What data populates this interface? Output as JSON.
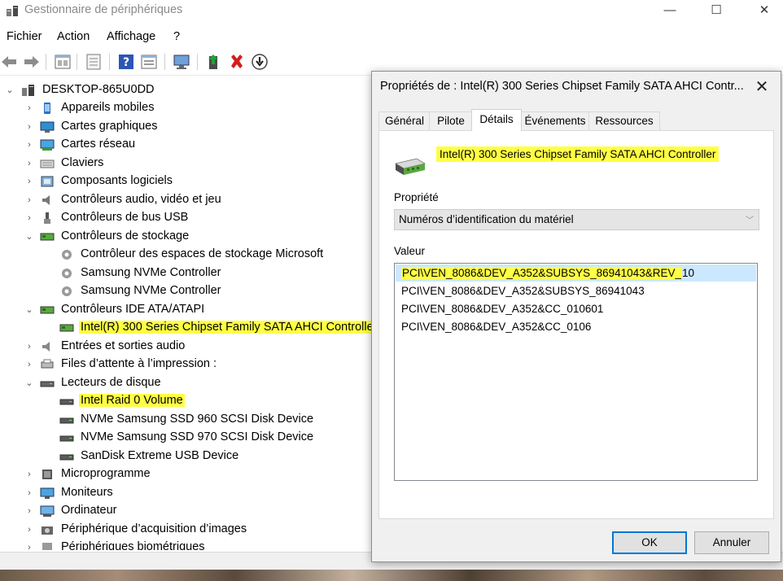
{
  "window": {
    "title": "Gestionnaire de périphériques",
    "minimize": "—",
    "maximize": "☐",
    "close": "✕"
  },
  "menu": [
    "Fichier",
    "Action",
    "Affichage",
    "?"
  ],
  "toolbar_icons": [
    "back-arrow-icon",
    "forward-arrow-icon",
    "properties-view-icon",
    "show-hidden-icon",
    "help-icon",
    "action-list-icon",
    "scan-hardware-icon",
    "enable-device-icon",
    "uninstall-device-icon",
    "update-driver-icon"
  ],
  "tree": {
    "root": "DESKTOP-865U0DD",
    "items": [
      {
        "label": "Appareils mobiles",
        "expanded": false,
        "level": 1
      },
      {
        "label": "Cartes graphiques",
        "expanded": false,
        "level": 1
      },
      {
        "label": "Cartes réseau",
        "expanded": false,
        "level": 1
      },
      {
        "label": "Claviers",
        "expanded": false,
        "level": 1
      },
      {
        "label": "Composants logiciels",
        "expanded": false,
        "level": 1
      },
      {
        "label": "Contrôleurs audio, vidéo et jeu",
        "expanded": false,
        "level": 1
      },
      {
        "label": "Contrôleurs de bus USB",
        "expanded": false,
        "level": 1
      },
      {
        "label": "Contrôleurs de stockage",
        "expanded": true,
        "level": 1
      },
      {
        "label": "Contrôleur des espaces de stockage Microsoft",
        "level": 2
      },
      {
        "label": "Samsung NVMe Controller",
        "level": 2
      },
      {
        "label": "Samsung NVMe Controller",
        "level": 2
      },
      {
        "label": "Contrôleurs IDE ATA/ATAPI",
        "expanded": true,
        "level": 1
      },
      {
        "label": "Intel(R) 300 Series Chipset Family SATA AHCI Controller",
        "level": 2,
        "highlighted": true
      },
      {
        "label": "Entrées et sorties audio",
        "expanded": false,
        "level": 1
      },
      {
        "label": "Files d’attente à l’impression :",
        "expanded": false,
        "level": 1
      },
      {
        "label": "Lecteurs de disque",
        "expanded": true,
        "level": 1
      },
      {
        "label": "Intel Raid 0 Volume",
        "level": 2,
        "highlighted": true
      },
      {
        "label": "NVMe Samsung SSD 960 SCSI Disk Device",
        "level": 2
      },
      {
        "label": "NVMe Samsung SSD 970 SCSI Disk Device",
        "level": 2
      },
      {
        "label": "SanDisk Extreme USB Device",
        "level": 2
      },
      {
        "label": "Microprogramme",
        "expanded": false,
        "level": 1
      },
      {
        "label": "Moniteurs",
        "expanded": false,
        "level": 1
      },
      {
        "label": "Ordinateur",
        "expanded": false,
        "level": 1
      },
      {
        "label": "Périphérique d’acquisition d’images",
        "expanded": false,
        "level": 1
      },
      {
        "label": "Périphériques biométriques",
        "expanded": false,
        "level": 1
      }
    ]
  },
  "dialog": {
    "title": "Propriétés de : Intel(R) 300 Series Chipset Family SATA AHCI Contr...",
    "close": "✕",
    "tabs": [
      "Général",
      "Pilote",
      "Détails",
      "Événements",
      "Ressources"
    ],
    "active_tab": "Détails",
    "device_name": "Intel(R) 300 Series Chipset Family SATA AHCI Controller",
    "property_label": "Propriété",
    "property_value": "Numéros d’identification du matériel",
    "value_label": "Valeur",
    "values": [
      {
        "hl": "PCI\\VEN_8086&DEV_A352&SUBSYS_86941043&REV_",
        "rest": "10"
      },
      {
        "hl": "",
        "rest": "PCI\\VEN_8086&DEV_A352&SUBSYS_86941043"
      },
      {
        "hl": "",
        "rest": "PCI\\VEN_8086&DEV_A352&CC_010601"
      },
      {
        "hl": "",
        "rest": "PCI\\VEN_8086&DEV_A352&CC_0106"
      }
    ],
    "ok_label": "OK",
    "cancel_label": "Annuler"
  },
  "colors": {
    "highlight": "#ffff44",
    "selection": "#cce8ff",
    "accent": "#0078d7"
  }
}
